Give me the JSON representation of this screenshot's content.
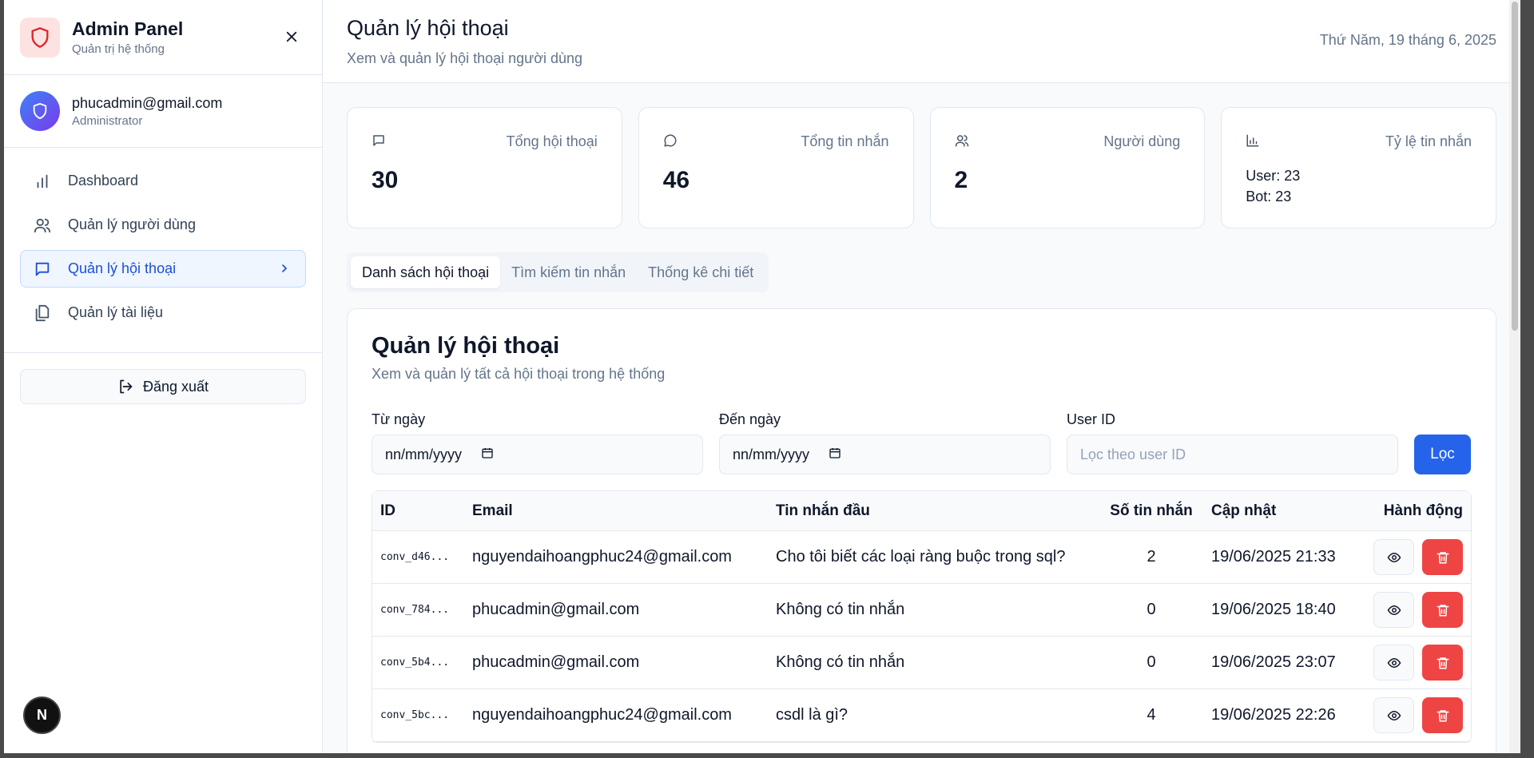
{
  "sidebar": {
    "brand_title": "Admin Panel",
    "brand_subtitle": "Quản trị hệ thống",
    "user_email": "phucadmin@gmail.com",
    "user_role": "Administrator",
    "items": [
      {
        "label": "Dashboard",
        "icon": "bar-chart-icon"
      },
      {
        "label": "Quản lý người dùng",
        "icon": "users-icon"
      },
      {
        "label": "Quản lý hội thoại",
        "icon": "message-square-icon",
        "active": true
      },
      {
        "label": "Quản lý tài liệu",
        "icon": "files-icon"
      }
    ],
    "logout_label": "Đăng xuất",
    "badge": "N"
  },
  "header": {
    "title": "Quản lý hội thoại",
    "subtitle": "Xem và quản lý hội thoại người dùng",
    "date": "Thứ Năm, 19 tháng 6, 2025"
  },
  "stats": [
    {
      "label": "Tổng hội thoại",
      "value": "30",
      "icon": "message-square-icon"
    },
    {
      "label": "Tổng tin nhắn",
      "value": "46",
      "icon": "message-circle-icon"
    },
    {
      "label": "Người dùng",
      "value": "2",
      "icon": "users-icon"
    },
    {
      "label": "Tỷ lệ tin nhắn",
      "line1": "User: 23",
      "line2": "Bot: 23",
      "icon": "bar-chart-icon"
    }
  ],
  "tabs": [
    "Danh sách hội thoại",
    "Tìm kiếm tin nhắn",
    "Thống kê chi tiết"
  ],
  "panel": {
    "title": "Quản lý hội thoại",
    "subtitle": "Xem và quản lý tất cả hội thoại trong hệ thống",
    "from_label": "Từ ngày",
    "from_value": "nn/mm/yyyy",
    "to_label": "Đến ngày",
    "to_value": "nn/mm/yyyy",
    "user_label": "User ID",
    "user_placeholder": "Lọc theo user ID",
    "filter_button": "Lọc"
  },
  "table": {
    "columns": [
      "ID",
      "Email",
      "Tin nhắn đầu",
      "Số tin nhắn",
      "Cập nhật",
      "Hành động"
    ],
    "rows": [
      {
        "id": "conv_d46...",
        "email": "nguyendaihoangphuc24@gmail.com",
        "first": "Cho tôi biết các loại ràng buộc trong sql?",
        "count": "2",
        "updated": "19/06/2025 21:33"
      },
      {
        "id": "conv_784...",
        "email": "phucadmin@gmail.com",
        "first": "Không có tin nhắn",
        "count": "0",
        "updated": "19/06/2025 18:40"
      },
      {
        "id": "conv_5b4...",
        "email": "phucadmin@gmail.com",
        "first": "Không có tin nhắn",
        "count": "0",
        "updated": "19/06/2025 23:07"
      },
      {
        "id": "conv_5bc...",
        "email": "nguyendaihoangphuc24@gmail.com",
        "first": "csdl là gì?",
        "count": "4",
        "updated": "19/06/2025 22:26"
      }
    ]
  },
  "colors": {
    "accent": "#2563eb",
    "danger": "#ef4444",
    "logo_red": "#dc2626"
  }
}
